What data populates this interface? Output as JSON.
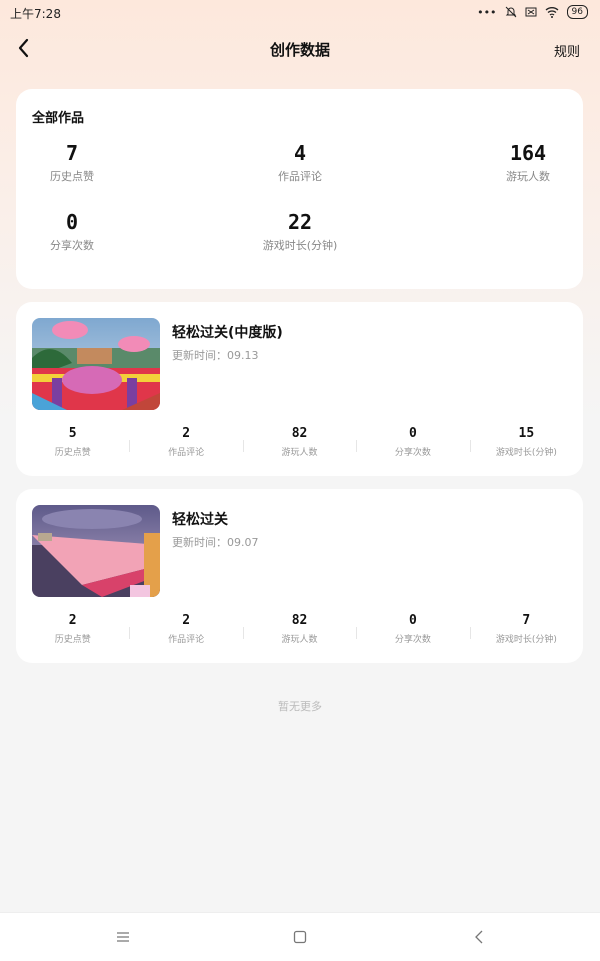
{
  "status_bar": {
    "time": "上午7:28",
    "icons": [
      "more-icon",
      "mute-icon",
      "sim-off-icon",
      "wifi-icon"
    ],
    "battery": "96"
  },
  "header": {
    "title": "创作数据",
    "rule_label": "规则"
  },
  "summary": {
    "title": "全部作品",
    "stats": [
      {
        "value": "7",
        "label": "历史点赞"
      },
      {
        "value": "4",
        "label": "作品评论"
      },
      {
        "value": "164",
        "label": "游玩人数"
      },
      {
        "value": "0",
        "label": "分享次数"
      },
      {
        "value": "22",
        "label": "游戏时长(分钟)"
      }
    ]
  },
  "works": [
    {
      "title": "轻松过关(中度版)",
      "update": "更新时间：09.13",
      "stats": [
        {
          "value": "5",
          "label": "历史点赞"
        },
        {
          "value": "2",
          "label": "作品评论"
        },
        {
          "value": "82",
          "label": "游玩人数"
        },
        {
          "value": "0",
          "label": "分享次数"
        },
        {
          "value": "15",
          "label": "游戏时长(分钟)"
        }
      ]
    },
    {
      "title": "轻松过关",
      "update": "更新时间：09.07",
      "stats": [
        {
          "value": "2",
          "label": "历史点赞"
        },
        {
          "value": "2",
          "label": "作品评论"
        },
        {
          "value": "82",
          "label": "游玩人数"
        },
        {
          "value": "0",
          "label": "分享次数"
        },
        {
          "value": "7",
          "label": "游戏时长(分钟)"
        }
      ]
    }
  ],
  "footer": {
    "no_more": "暂无更多"
  },
  "bottom_nav": [
    "menu-icon",
    "home-icon",
    "back-icon"
  ]
}
